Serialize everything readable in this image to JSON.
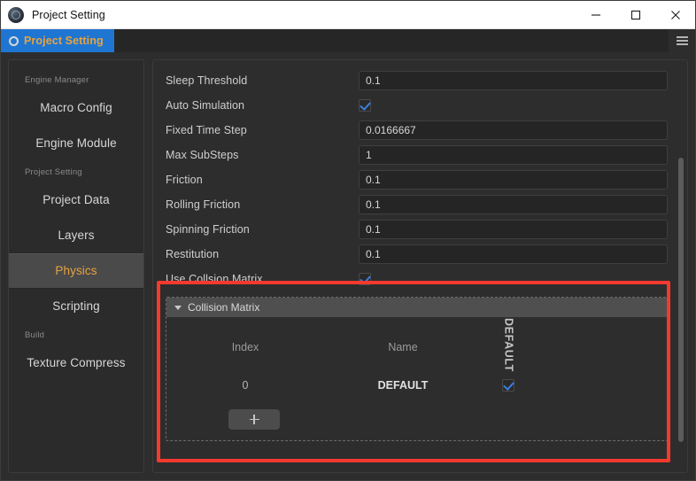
{
  "window": {
    "title": "Project Setting",
    "icon": "app-icon",
    "controls": {
      "minimize": "minimize-icon",
      "maximize": "maximize-icon",
      "close": "close-icon"
    }
  },
  "tabbar": {
    "tab_label": "Project Setting",
    "tab_icon": "gear-icon",
    "menu_icon": "hamburger-icon"
  },
  "sidebar": {
    "groups": [
      {
        "label": "Engine Manager",
        "items": [
          {
            "label": "Macro Config",
            "active": false
          },
          {
            "label": "Engine Module",
            "active": false
          }
        ]
      },
      {
        "label": "Project Setting",
        "items": [
          {
            "label": "Project Data",
            "active": false
          },
          {
            "label": "Layers",
            "active": false
          },
          {
            "label": "Physics",
            "active": true
          },
          {
            "label": "Scripting",
            "active": false
          }
        ]
      },
      {
        "label": "Build",
        "items": [
          {
            "label": "Texture Compress",
            "active": false
          }
        ]
      }
    ]
  },
  "form": {
    "fields": [
      {
        "label": "Sleep Threshold",
        "type": "text",
        "value": "0.1"
      },
      {
        "label": "Auto Simulation",
        "type": "checkbox",
        "checked": true
      },
      {
        "label": "Fixed Time Step",
        "type": "text",
        "value": "0.0166667"
      },
      {
        "label": "Max SubSteps",
        "type": "text",
        "value": "1"
      },
      {
        "label": "Friction",
        "type": "text",
        "value": "0.1"
      },
      {
        "label": "Rolling Friction",
        "type": "text",
        "value": "0.1"
      },
      {
        "label": "Spinning Friction",
        "type": "text",
        "value": "0.1"
      },
      {
        "label": "Restitution",
        "type": "text",
        "value": "0.1"
      },
      {
        "label": "Use Collsion Matrix",
        "type": "checkbox",
        "checked": true
      }
    ]
  },
  "collision_matrix": {
    "title": "Collision Matrix",
    "expanded": true,
    "caret_icon": "caret-down-icon",
    "columns": [
      "Index",
      "Name"
    ],
    "layer_columns": [
      "DEFAULT"
    ],
    "rows": [
      {
        "index": "0",
        "name": "DEFAULT",
        "checks": [
          true
        ]
      }
    ],
    "add_button": "+"
  },
  "colors": {
    "accent_tab_bg": "#1f76d2",
    "accent_text": "#e8a33d",
    "checkbox_check": "#3c7fe0",
    "annotation": "#f4392f",
    "panel_bg": "#2d2d2d",
    "input_bg": "#252525"
  }
}
